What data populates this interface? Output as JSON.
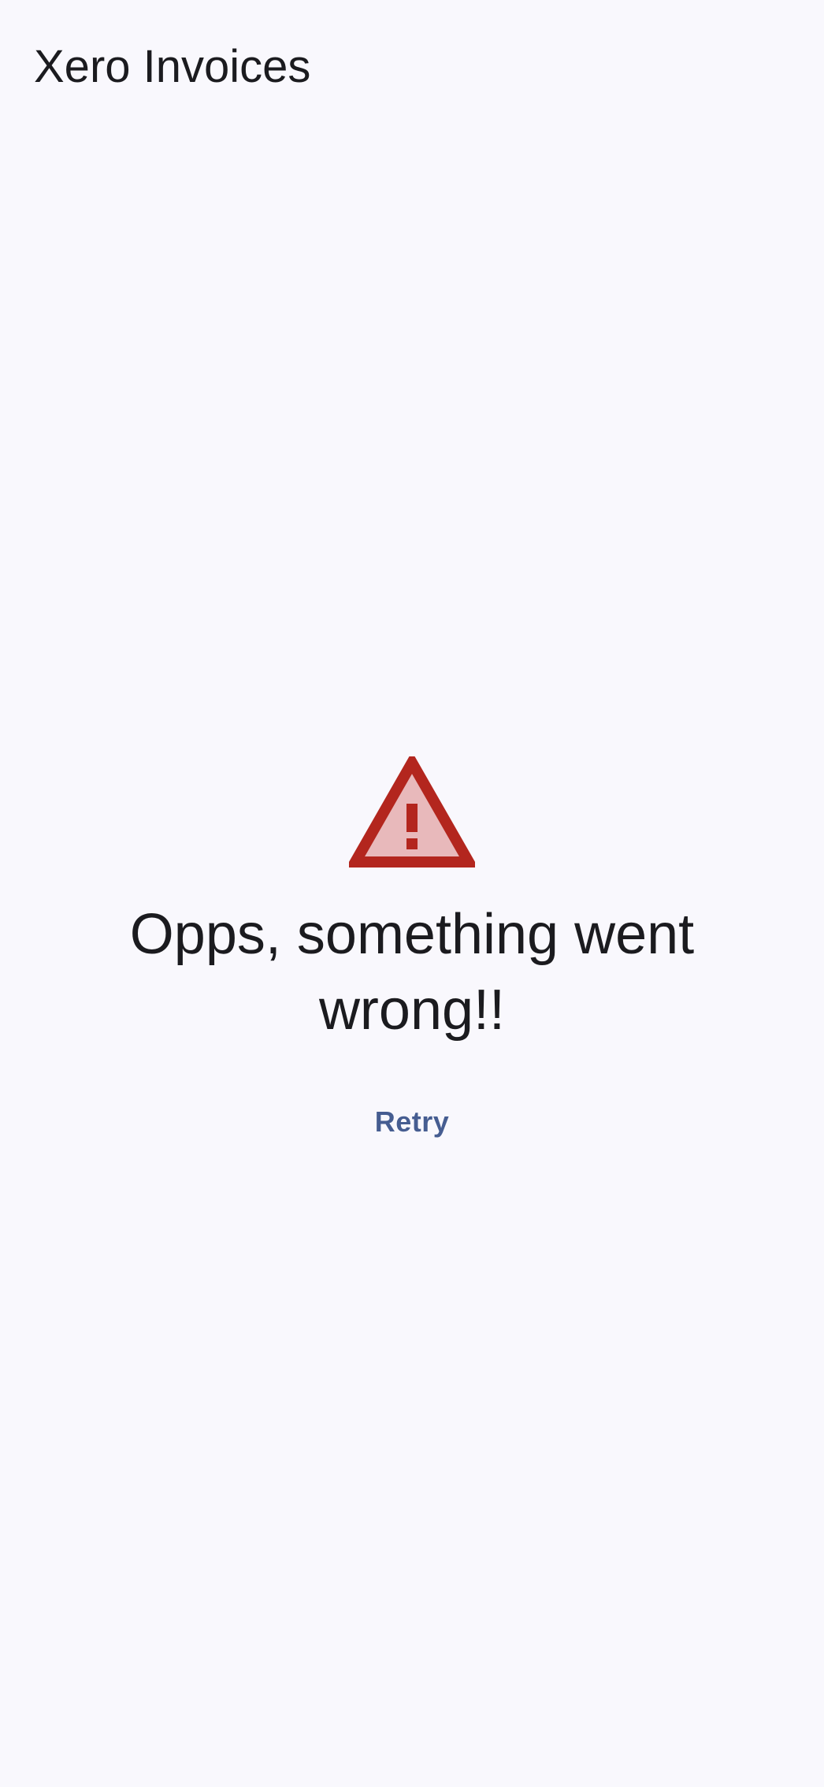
{
  "app_bar": {
    "title": "Xero Invoices"
  },
  "error": {
    "icon": "warning-icon",
    "message": "Opps, something went wrong!!",
    "retry_label": "Retry"
  },
  "colors": {
    "background": "#f9f8fd",
    "text": "#1b1b1f",
    "warning_red": "#b3261e",
    "warning_fill": "#e8b9bb",
    "retry_text": "#465d91"
  }
}
